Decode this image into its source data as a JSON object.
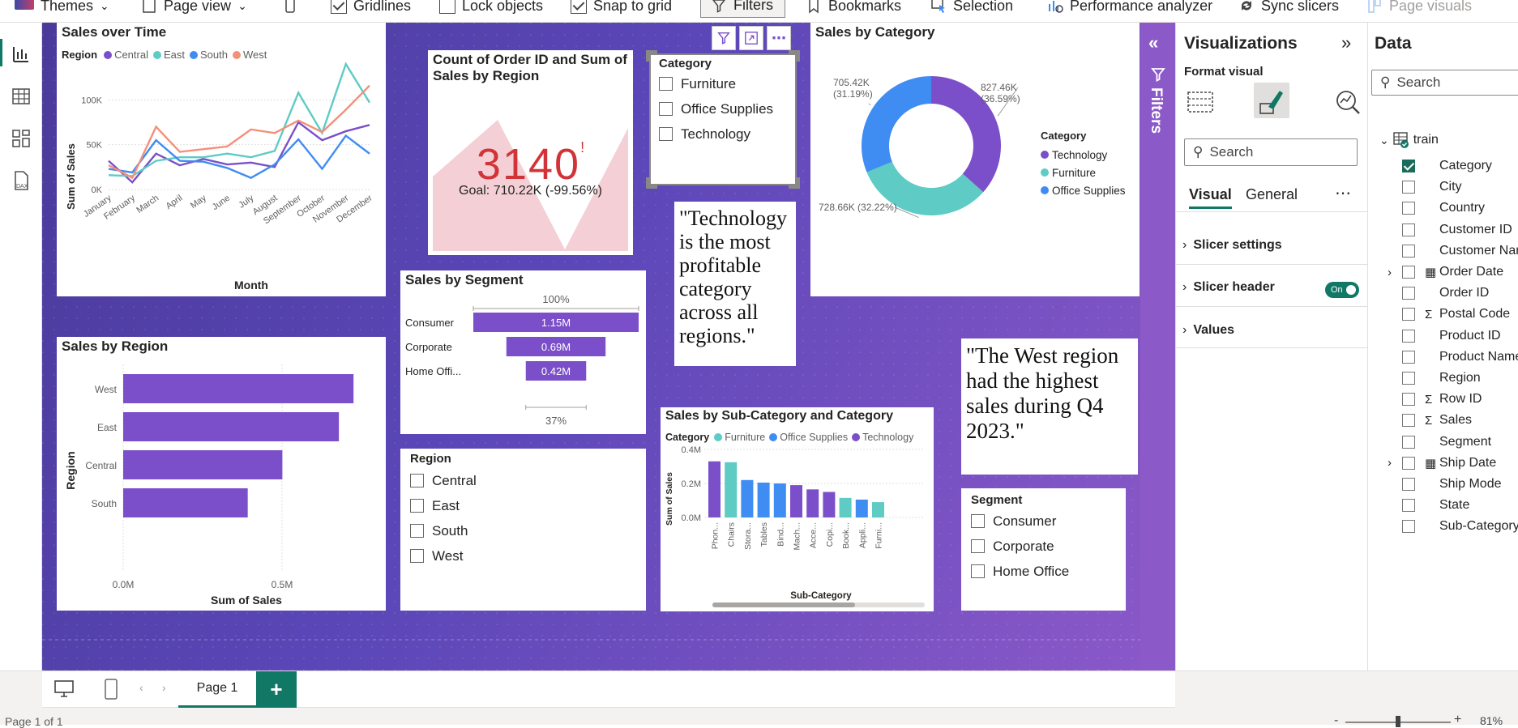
{
  "toolbar": {
    "items": [
      {
        "label": "Themes"
      },
      {
        "label": "Page view"
      },
      {
        "label": "Gridlines"
      },
      {
        "label": "Lock objects"
      },
      {
        "label": "Snap to grid"
      },
      {
        "label": "Filters"
      },
      {
        "label": "Bookmarks"
      },
      {
        "label": "Selection"
      },
      {
        "label": "Performance analyzer"
      },
      {
        "label": "Sync slicers"
      },
      {
        "label": "Page visuals"
      }
    ]
  },
  "sales_over_time": {
    "title": "Sales over Time",
    "legend_title": "Region",
    "ylabel": "Sum of Sales",
    "xlabel": "Month"
  },
  "kpi": {
    "title": "Count of Order ID and Sum of Sales by Region",
    "value": "3140",
    "flag": "!",
    "goal": "Goal: 710.22K (-99.56%)"
  },
  "category_slicer": {
    "title": "Category",
    "items": [
      "Furniture",
      "Office Supplies",
      "Technology"
    ]
  },
  "sales_by_category": {
    "title": "Sales by Category",
    "legend_title": "Category"
  },
  "sales_by_segment": {
    "title": "Sales by Segment",
    "top_label": "100%",
    "bottom_label": "37%"
  },
  "quote1": {
    "text": "\"Technology is the most profitable category across all regions.\""
  },
  "quote2": {
    "text": "\"The West region had the highest sales during Q4 2023.\""
  },
  "sales_by_region": {
    "title": "Sales by Region",
    "ylabel": "Region",
    "xlabel": "Sum of Sales"
  },
  "region_slicer": {
    "title": "Region",
    "items": [
      "Central",
      "East",
      "South",
      "West"
    ]
  },
  "sales_by_subcat": {
    "title": "Sales by Sub-Category and Category",
    "legend_title": "Category",
    "ylabel": "Sum of Sales",
    "xlabel": "Sub-Category"
  },
  "segment_slicer": {
    "title": "Segment",
    "items": [
      "Consumer",
      "Corporate",
      "Home Office"
    ]
  },
  "filters_tab": {
    "label": "Filters"
  },
  "visualizations": {
    "title": "Visualizations",
    "format_label": "Format visual",
    "search_placeholder": "Search",
    "tab_visual": "Visual",
    "tab_general": "General",
    "sections": [
      "Slicer settings",
      "Slicer header",
      "Values"
    ],
    "toggle_label": "On"
  },
  "data_pane": {
    "title": "Data",
    "search_placeholder": "Search",
    "table_name": "train",
    "fields": [
      {
        "name": "Category",
        "checked": true,
        "sigma": false,
        "calendar": false
      },
      {
        "name": "City",
        "checked": false,
        "sigma": false,
        "calendar": false
      },
      {
        "name": "Country",
        "checked": false,
        "sigma": false,
        "calendar": false
      },
      {
        "name": "Customer ID",
        "checked": false,
        "sigma": false,
        "calendar": false
      },
      {
        "name": "Customer Name",
        "checked": false,
        "sigma": false,
        "calendar": false
      },
      {
        "name": "Order Date",
        "checked": false,
        "sigma": false,
        "calendar": true
      },
      {
        "name": "Order ID",
        "checked": false,
        "sigma": false,
        "calendar": false
      },
      {
        "name": "Postal Code",
        "checked": false,
        "sigma": true,
        "calendar": false
      },
      {
        "name": "Product ID",
        "checked": false,
        "sigma": false,
        "calendar": false
      },
      {
        "name": "Product Name",
        "checked": false,
        "sigma": false,
        "calendar": false
      },
      {
        "name": "Region",
        "checked": false,
        "sigma": false,
        "calendar": false
      },
      {
        "name": "Row ID",
        "checked": false,
        "sigma": true,
        "calendar": false
      },
      {
        "name": "Sales",
        "checked": false,
        "sigma": true,
        "calendar": false
      },
      {
        "name": "Segment",
        "checked": false,
        "sigma": false,
        "calendar": false
      },
      {
        "name": "Ship Date",
        "checked": false,
        "sigma": false,
        "calendar": true
      },
      {
        "name": "Ship Mode",
        "checked": false,
        "sigma": false,
        "calendar": false
      },
      {
        "name": "State",
        "checked": false,
        "sigma": false,
        "calendar": false
      },
      {
        "name": "Sub-Category",
        "checked": false,
        "sigma": false,
        "calendar": false
      }
    ]
  },
  "bottom_bar": {
    "page_tab": "Page 1",
    "add_tab": "+",
    "status": "Page 1 of 1",
    "zoom": "81%",
    "zoom_fraction": 0.5
  },
  "colors": {
    "central": "#7b4fc9",
    "east": "#5ecbc5",
    "south": "#3f8cf2",
    "west": "#f4907a",
    "bar": "#7b4fc9",
    "kpi_red": "#d13438",
    "accent_green": "#117865"
  },
  "chart_data": [
    {
      "id": "sales_over_time",
      "type": "line",
      "x": [
        "January",
        "February",
        "March",
        "April",
        "May",
        "June",
        "July",
        "August",
        "September",
        "October",
        "November",
        "December"
      ],
      "series": [
        {
          "name": "Central",
          "values": [
            32,
            8,
            40,
            27,
            34,
            28,
            30,
            25,
            75,
            55,
            65,
            72
          ]
        },
        {
          "name": "East",
          "values": [
            16,
            15,
            32,
            36,
            36,
            40,
            36,
            43,
            108,
            63,
            140,
            97
          ]
        },
        {
          "name": "South",
          "values": [
            23,
            19,
            55,
            32,
            31,
            24,
            13,
            28,
            56,
            23,
            60,
            40
          ]
        },
        {
          "name": "West",
          "values": [
            27,
            13,
            70,
            42,
            45,
            48,
            67,
            63,
            77,
            64,
            89,
            116
          ]
        }
      ],
      "ytick_labels": [
        "0K",
        "50K",
        "100K"
      ],
      "ylim": [
        0,
        150
      ]
    },
    {
      "id": "sales_by_category",
      "type": "pie",
      "donut": true,
      "categories": [
        "Technology",
        "Furniture",
        "Office Supplies"
      ],
      "values": [
        827.46,
        728.66,
        705.42
      ],
      "labels": [
        "827.46K (36.59%)",
        "728.66K (32.22%)",
        "705.42K (31.19%)"
      ]
    },
    {
      "id": "sales_by_segment",
      "type": "bar",
      "orientation": "funnel",
      "categories": [
        "Consumer",
        "Corporate",
        "Home Offi..."
      ],
      "values": [
        1.15,
        0.69,
        0.42
      ],
      "labels": [
        "1.15M",
        "0.69M",
        "0.42M"
      ]
    },
    {
      "id": "sales_by_region",
      "type": "bar",
      "orientation": "horizontal",
      "categories": [
        "West",
        "East",
        "Central",
        "South"
      ],
      "values": [
        0.725,
        0.679,
        0.501,
        0.392
      ],
      "xtick_labels": [
        "0.0M",
        "0.5M"
      ],
      "xlim": [
        0,
        0.75
      ]
    },
    {
      "id": "sales_by_subcat",
      "type": "bar",
      "categories": [
        "Phon...",
        "Chairs",
        "Stora...",
        "Tables",
        "Bind...",
        "Mach...",
        "Acce...",
        "Copi...",
        "Book...",
        "Appli...",
        "Furni..."
      ],
      "category_group": [
        "Technology",
        "Furniture",
        "Office Supplies",
        "Office Supplies",
        "Office Supplies",
        "Technology",
        "Technology",
        "Technology",
        "Furniture",
        "Office Supplies",
        "Furniture"
      ],
      "values": [
        0.33,
        0.325,
        0.22,
        0.205,
        0.2,
        0.19,
        0.165,
        0.15,
        0.115,
        0.105,
        0.09
      ],
      "legend": [
        "Furniture",
        "Office Supplies",
        "Technology"
      ],
      "ytick_labels": [
        "0.0M",
        "0.2M",
        "0.4M"
      ],
      "ylim": [
        0,
        0.4
      ]
    }
  ]
}
